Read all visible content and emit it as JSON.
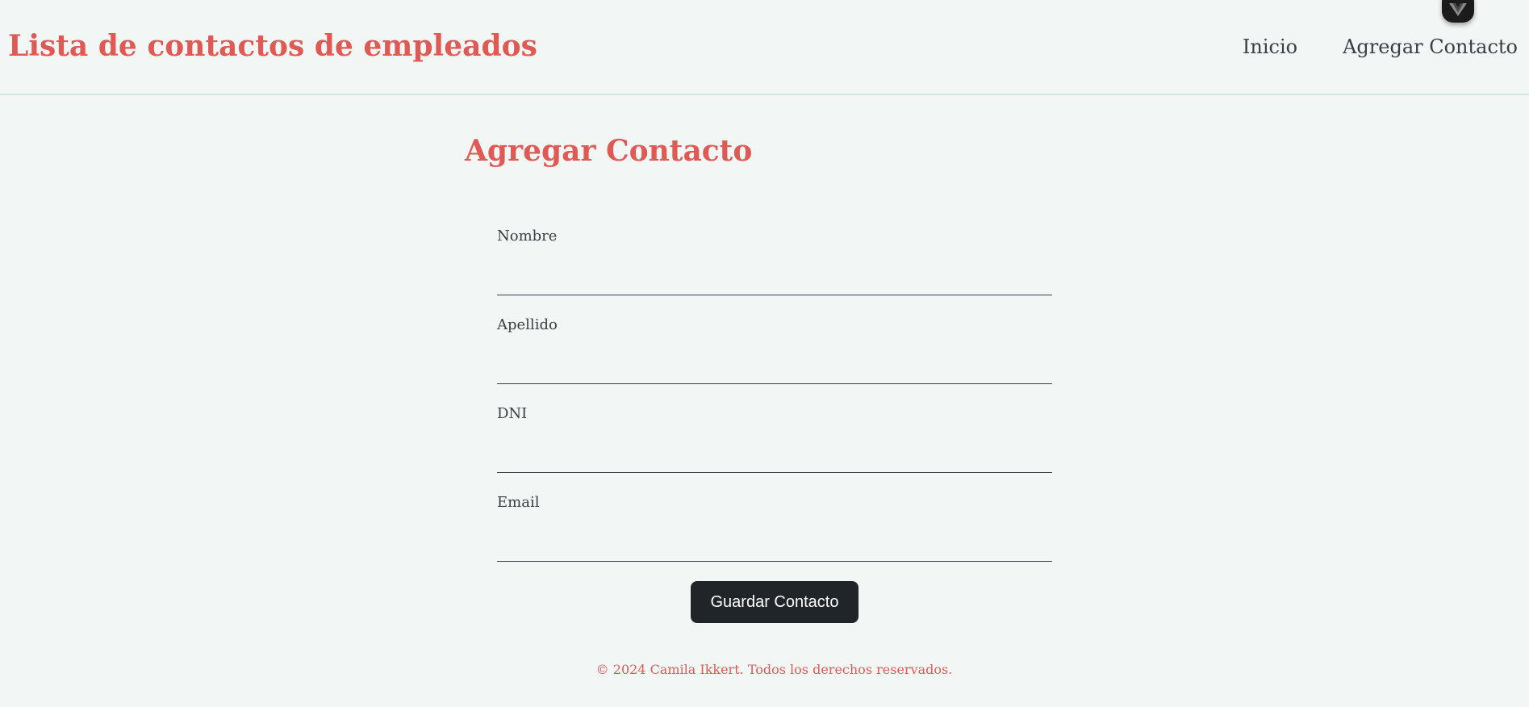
{
  "header": {
    "title": "Lista de contactos de empleados",
    "nav": [
      "Inicio",
      "Agregar Contacto"
    ]
  },
  "devtools_tab": {
    "icon": "vue-logo-icon"
  },
  "page": {
    "title": "Agregar Contacto"
  },
  "form": {
    "fields": [
      {
        "label": "Nombre",
        "value": ""
      },
      {
        "label": "Apellido",
        "value": ""
      },
      {
        "label": "DNI",
        "value": ""
      },
      {
        "label": "Email",
        "value": ""
      }
    ],
    "submit_label": "Guardar Contacto"
  },
  "footer": {
    "text": "© 2024 Camila Ikkert. Todos los derechos reservados."
  },
  "colors": {
    "background": "#f2f7f5",
    "accent": "#e05a55",
    "text": "#3a3f45",
    "button": "#1f2528"
  }
}
